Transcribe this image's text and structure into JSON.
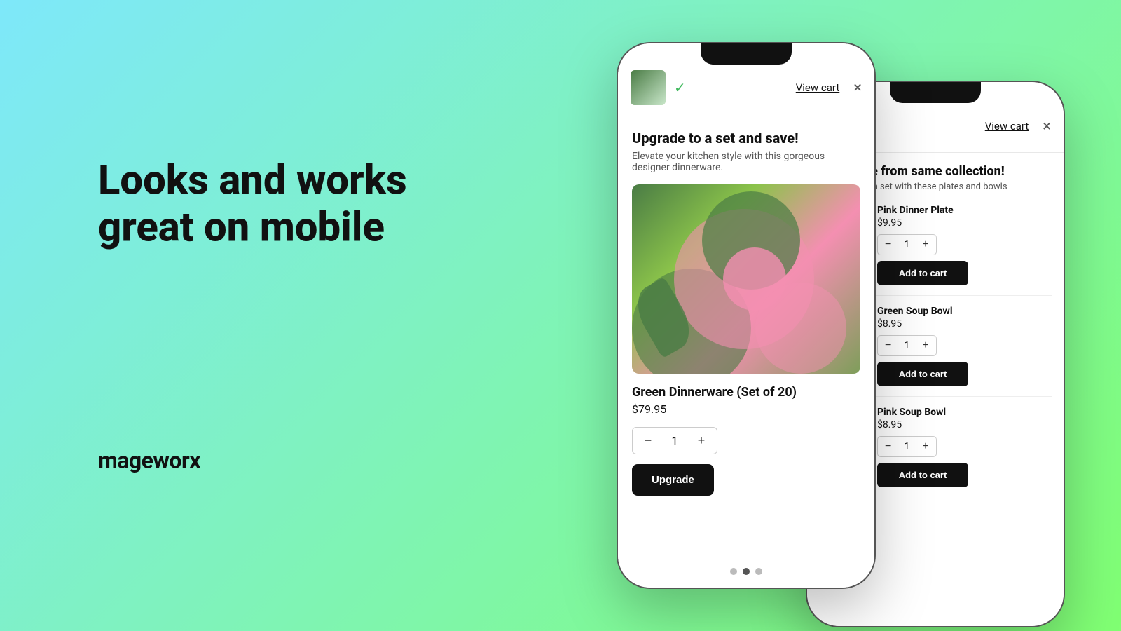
{
  "background": {
    "gradient_start": "#7ee8fa",
    "gradient_end": "#80ff72"
  },
  "left_section": {
    "headline": "Looks and works great on mobile",
    "brand": "mageworx"
  },
  "phone1": {
    "header": {
      "view_cart_label": "View cart",
      "close_icon": "×",
      "check_icon": "✓"
    },
    "body": {
      "upgrade_title": "Upgrade to a set and save!",
      "upgrade_subtitle": "Elevate your kitchen style with this gorgeous designer dinnerware.",
      "product_name": "Green Dinnerware (Set of 20)",
      "product_price": "$79.95",
      "quantity": "1",
      "upgrade_button_label": "Upgrade"
    },
    "dots": [
      "dot",
      "dot-active",
      "dot"
    ]
  },
  "phone2": {
    "header": {
      "view_cart_label": "View cart",
      "close_icon": "×",
      "check_icon": "✓"
    },
    "body": {
      "section_title": "Grab more from same collection!",
      "section_subtitle": "Build your own set with these plates and bowls",
      "products": [
        {
          "name": "Pink Dinner Plate",
          "price": "$9.95",
          "quantity": "1",
          "add_to_cart_label": "Add to cart",
          "thumb_class": "thumb-pink"
        },
        {
          "name": "Green Soup Bowl",
          "price": "$8.95",
          "quantity": "1",
          "add_to_cart_label": "Add to cart",
          "thumb_class": "thumb-green"
        },
        {
          "name": "Pink Soup Bowl",
          "price": "$8.95",
          "quantity": "1",
          "add_to_cart_label": "Add to cart",
          "thumb_class": "thumb-pink2"
        }
      ]
    }
  }
}
